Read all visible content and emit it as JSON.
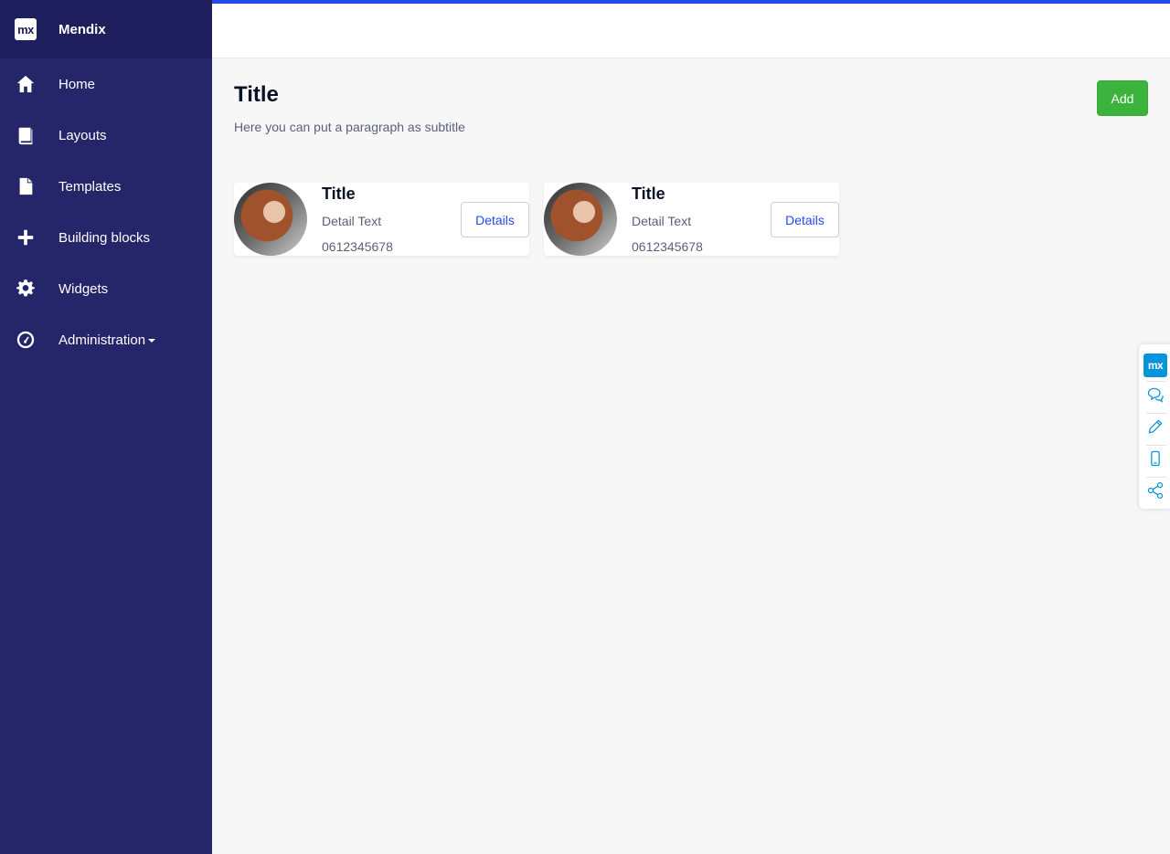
{
  "brand": {
    "logo_text": "mx",
    "name": "Mendix"
  },
  "sidebar": {
    "items": [
      {
        "label": "Home",
        "icon": "home-icon"
      },
      {
        "label": "Layouts",
        "icon": "book-icon"
      },
      {
        "label": "Templates",
        "icon": "file-icon"
      },
      {
        "label": "Building blocks",
        "icon": "plus-icon"
      },
      {
        "label": "Widgets",
        "icon": "gear-icon"
      },
      {
        "label": "Administration",
        "icon": "dashboard-icon",
        "has_dropdown": true
      }
    ]
  },
  "page": {
    "title": "Title",
    "subtitle": "Here you can put a paragraph as subtitle",
    "add_label": "Add"
  },
  "cards": [
    {
      "title": "Title",
      "detail": "Detail Text",
      "phone": "0612345678",
      "button_label": "Details"
    },
    {
      "title": "Title",
      "detail": "Detail Text",
      "phone": "0612345678",
      "button_label": "Details"
    }
  ],
  "dock": {
    "logo_text": "mx",
    "icons": [
      "mx-logo-icon",
      "chat-icon",
      "pencil-icon",
      "mobile-icon",
      "share-icon"
    ]
  },
  "colors": {
    "sidebar": "#252669",
    "brand_bg": "#1e1f5c",
    "accent": "#264ae5",
    "success": "#3cb33d",
    "dock_accent": "#0595db"
  }
}
